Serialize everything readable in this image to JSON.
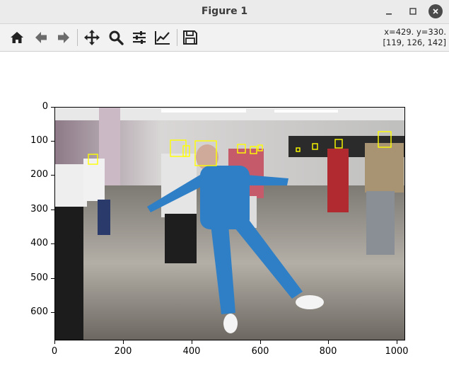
{
  "window": {
    "title": "Figure 1"
  },
  "toolbar": {
    "buttons": [
      "home-icon",
      "back-icon",
      "forward-icon",
      "pan-icon",
      "zoom-icon",
      "configure-subplots-icon",
      "edit-axis-icon",
      "save-icon"
    ]
  },
  "status": {
    "line1": "x=429. y=330.",
    "line2": "[119, 126, 142]"
  },
  "axes": {
    "xticks": [
      "0",
      "200",
      "400",
      "600",
      "800",
      "1000"
    ],
    "yticks": [
      "0",
      "100",
      "200",
      "300",
      "400",
      "500",
      "600"
    ]
  },
  "colors": {
    "box": "#ffff00",
    "floor": "#9a968e",
    "wall": "#dcdcdc",
    "blue": "#2f7fc6"
  }
}
